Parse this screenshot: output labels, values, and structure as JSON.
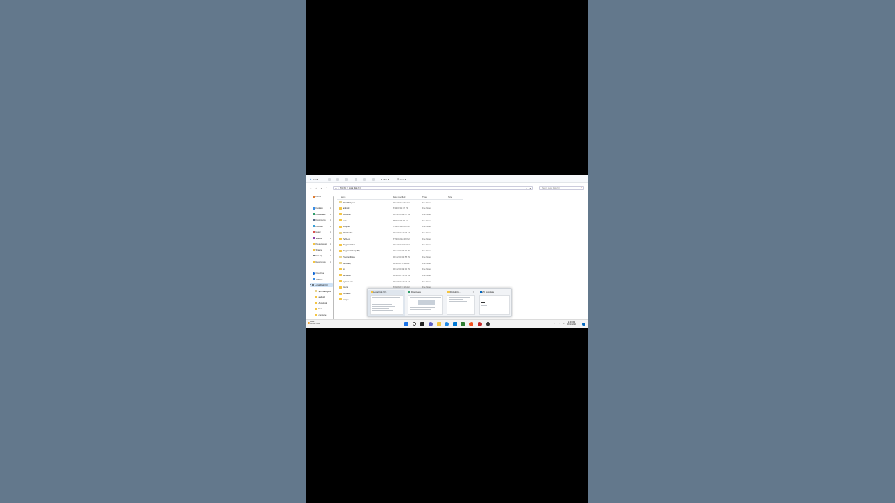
{
  "toolbar": {
    "new_label": "New",
    "sort_label": "Sort",
    "view_label": "View",
    "more_label": "···"
  },
  "address": {
    "crumbs": [
      "This PC",
      "Local Disk (C:)"
    ],
    "separators": [
      ">",
      ">"
    ],
    "search_placeholder": "Search Local Disk (C:)"
  },
  "sidebar": {
    "home": "Home",
    "pinned": [
      "Desktop",
      "Downloads",
      "Documents",
      "Pictures",
      "Music",
      "Videos",
      "Presentation",
      "Sharing",
      "Dat (D)",
      "Recordings"
    ],
    "onedrive": "OneDrive",
    "this_pc": "This PC",
    "drive": "Local Disk (C:)",
    "subitems": [
      "$WinREAgent",
      "android",
      "Autodesk",
      "boot",
      "compare"
    ]
  },
  "columns": [
    "Name",
    "Date modified",
    "Type",
    "Size"
  ],
  "files": [
    {
      "name": "$WinREAgent",
      "date": "10/5/2023 2:37 AM",
      "type": "File folder"
    },
    {
      "name": "android",
      "date": "8/4/2023 1:57 PM",
      "type": "File folder"
    },
    {
      "name": "Autodesk",
      "date": "10/31/2022 9:37 AM",
      "type": "File folder"
    },
    {
      "name": "boot",
      "date": "6/5/2023 3:33 AM",
      "type": "File folder"
    },
    {
      "name": "compare",
      "date": "4/5/2023 10:00 PM",
      "type": "File folder"
    },
    {
      "name": "MSOCache",
      "date": "12/8/2022 10:03 AM",
      "type": "File folder"
    },
    {
      "name": "PerfLogs",
      "date": "6/7/2022 12:49 PM",
      "type": "File folder"
    },
    {
      "name": "Program Files",
      "date": "10/5/2023 6:07 PM",
      "type": "File folder"
    },
    {
      "name": "Program Files (x86)",
      "date": "10/11/2023 3:00 PM",
      "type": "File folder"
    },
    {
      "name": "ProgramData",
      "date": "10/11/2023 2:58 PM",
      "type": "File folder"
    },
    {
      "name": "Recovery",
      "date": "12/8/2022 8:11 AM",
      "type": "File folder"
    },
    {
      "name": "src",
      "date": "10/11/2023 9:02 PM",
      "type": "File folder"
    },
    {
      "name": "SWSetup",
      "date": "12/8/2022 10:16 AM",
      "type": "File folder"
    },
    {
      "name": "System.sav",
      "date": "12/8/2022 10:29 AM",
      "type": "File folder"
    },
    {
      "name": "Users",
      "date": "6/20/2023 3:19 AM",
      "type": "File folder"
    },
    {
      "name": "Windows",
      "date": "",
      "type": ""
    },
    {
      "name": "xampp",
      "date": "",
      "type": ""
    }
  ],
  "task_previews": [
    {
      "title": "Local Disk (C:)"
    },
    {
      "title": "Downloads"
    },
    {
      "title": "Default Ca...",
      "close": "✕"
    },
    {
      "title": "2% complete"
    }
  ],
  "taskbar": {
    "weather_temp": "84°F",
    "weather_text": "Mostly clear",
    "tray_arrow": "^",
    "time": "9:48 PM",
    "date": "10/11/2023"
  },
  "colors": {
    "desktop_bg": "#63788c",
    "folder": "#f4c542",
    "selection": "#cfe3f7",
    "accent": "#0067c0"
  }
}
